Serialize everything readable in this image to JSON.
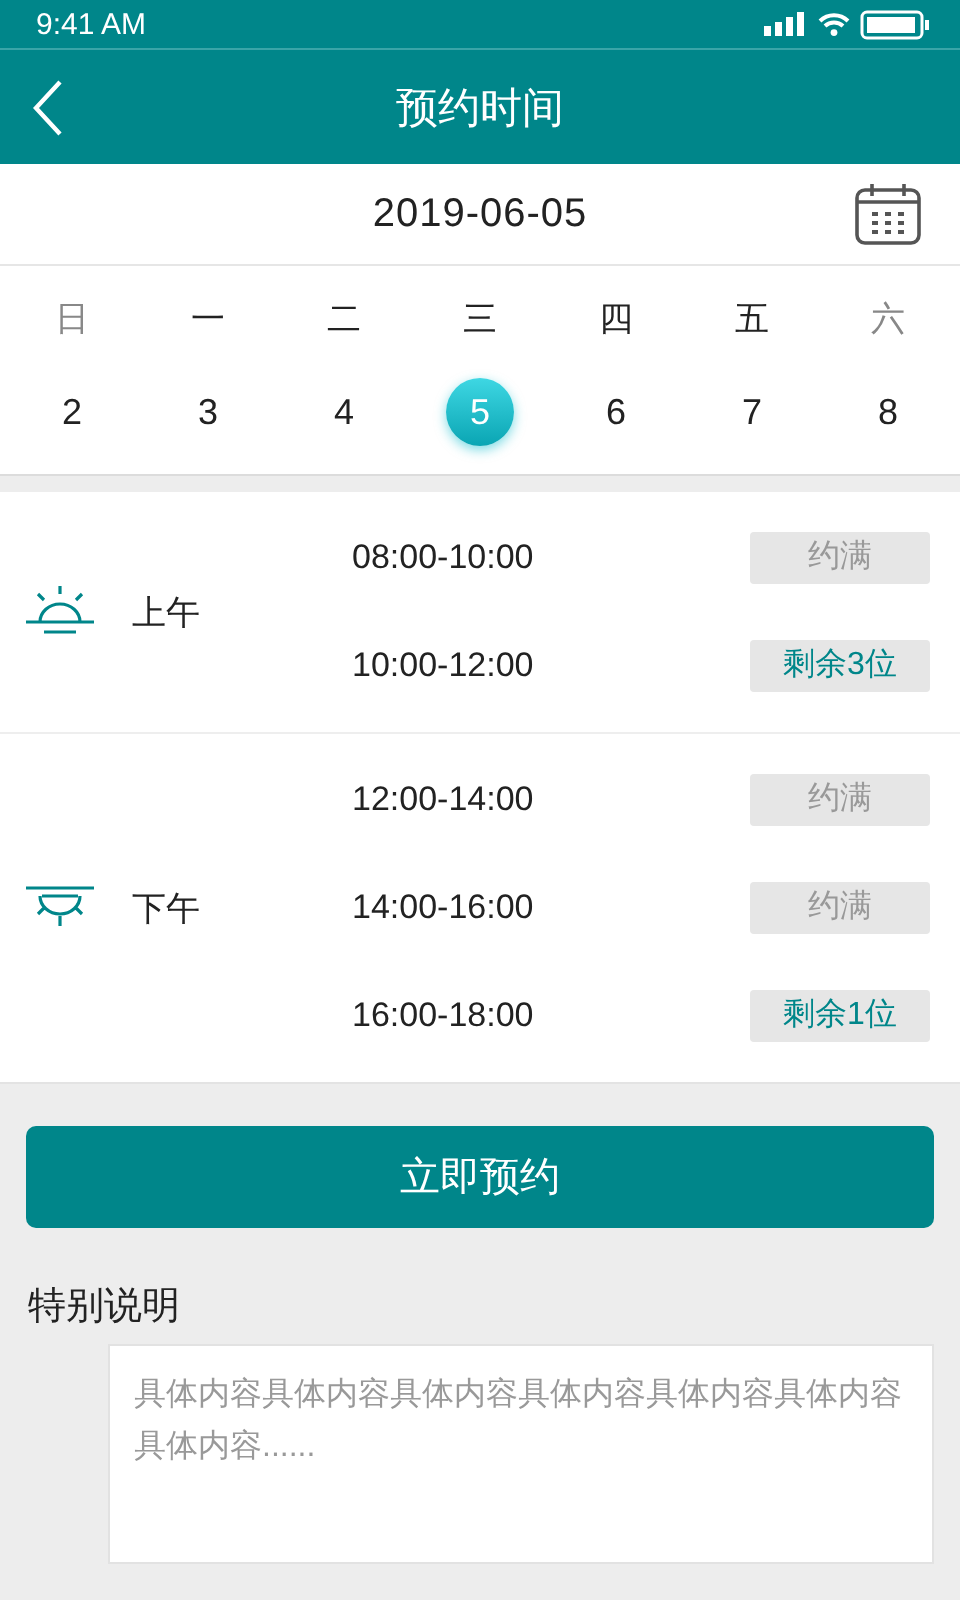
{
  "status_bar": {
    "time": "9:41 AM"
  },
  "nav": {
    "title": "预约时间"
  },
  "date_bar": {
    "date": "2019-06-05"
  },
  "week": {
    "days": [
      {
        "weekday": "日",
        "date": "2",
        "muted": true,
        "selected": false
      },
      {
        "weekday": "一",
        "date": "3",
        "muted": false,
        "selected": false
      },
      {
        "weekday": "二",
        "date": "4",
        "muted": false,
        "selected": false
      },
      {
        "weekday": "三",
        "date": "5",
        "muted": false,
        "selected": true
      },
      {
        "weekday": "四",
        "date": "6",
        "muted": false,
        "selected": false
      },
      {
        "weekday": "五",
        "date": "7",
        "muted": false,
        "selected": false
      },
      {
        "weekday": "六",
        "date": "8",
        "muted": true,
        "selected": false
      }
    ]
  },
  "sessions": [
    {
      "kind": "morning",
      "label": "上午",
      "slots": [
        {
          "time": "08:00-10:00",
          "available": false,
          "badge": "约满"
        },
        {
          "time": "10:00-12:00",
          "available": true,
          "badge": "剩余3位"
        }
      ]
    },
    {
      "kind": "afternoon",
      "label": "下午",
      "slots": [
        {
          "time": "12:00-14:00",
          "available": false,
          "badge": "约满"
        },
        {
          "time": "14:00-16:00",
          "available": false,
          "badge": "约满"
        },
        {
          "time": "16:00-18:00",
          "available": true,
          "badge": "剩余1位"
        }
      ]
    }
  ],
  "book_button": "立即预约",
  "notes": {
    "label": "特别说明",
    "placeholder": "具体内容具体内容具体内容具体内容具体内容具体内容具体内容......"
  }
}
